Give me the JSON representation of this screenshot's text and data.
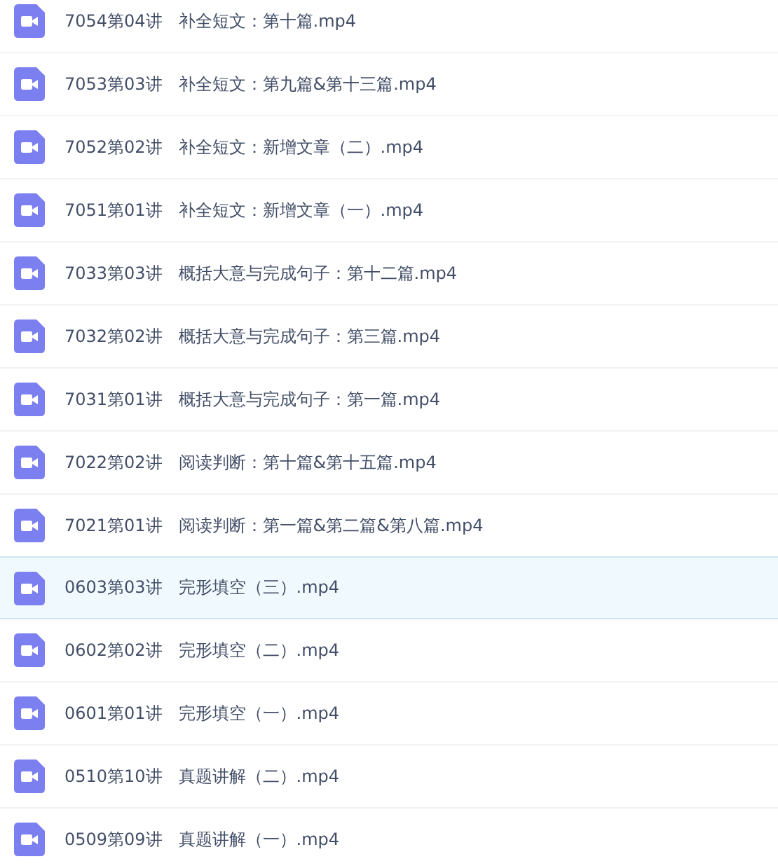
{
  "files": [
    {
      "name": "7054第04讲   补全短文：第十篇.mp4",
      "selected": false
    },
    {
      "name": "7053第03讲   补全短文：第九篇&第十三篇.mp4",
      "selected": false
    },
    {
      "name": "7052第02讲   补全短文：新增文章（二）.mp4",
      "selected": false
    },
    {
      "name": "7051第01讲   补全短文：新增文章（一）.mp4",
      "selected": false
    },
    {
      "name": "7033第03讲   概括大意与完成句子：第十二篇.mp4",
      "selected": false
    },
    {
      "name": "7032第02讲   概括大意与完成句子：第三篇.mp4",
      "selected": false
    },
    {
      "name": "7031第01讲   概括大意与完成句子：第一篇.mp4",
      "selected": false
    },
    {
      "name": "7022第02讲   阅读判断：第十篇&第十五篇.mp4",
      "selected": false
    },
    {
      "name": "7021第01讲   阅读判断：第一篇&第二篇&第八篇.mp4",
      "selected": false
    },
    {
      "name": "0603第03讲   完形填空（三）.mp4",
      "selected": true
    },
    {
      "name": "0602第02讲   完形填空（二）.mp4",
      "selected": false
    },
    {
      "name": "0601第01讲   完形填空（一）.mp4",
      "selected": false
    },
    {
      "name": "0510第10讲   真题讲解（二）.mp4",
      "selected": false
    },
    {
      "name": "0509第09讲   真题讲解（一）.mp4",
      "selected": false
    }
  ]
}
